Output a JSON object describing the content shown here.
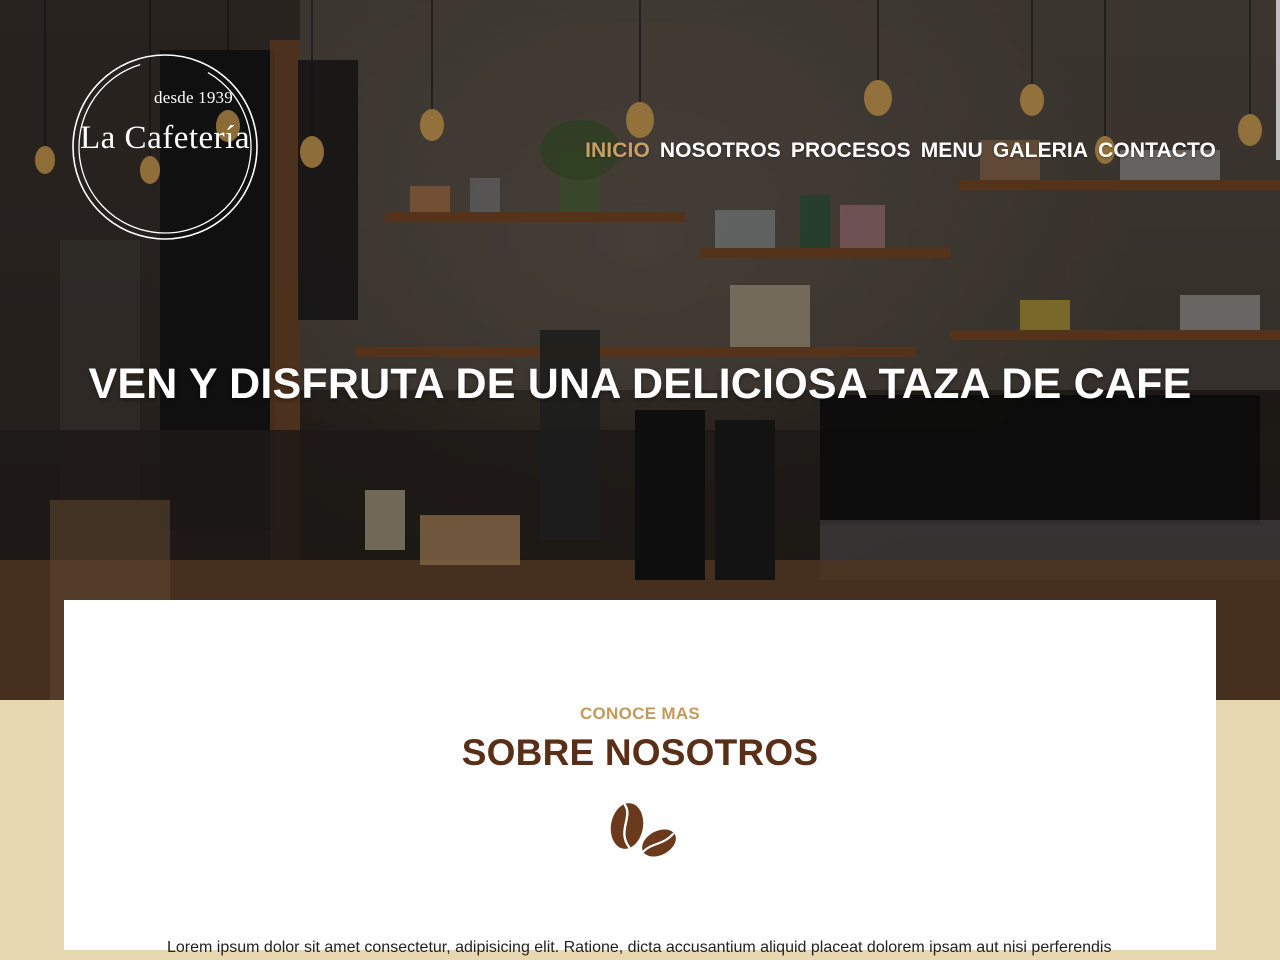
{
  "logo": {
    "since": "desde 1939",
    "name": "La Cafetería"
  },
  "nav": {
    "items": [
      {
        "label": "INICIO",
        "active": true
      },
      {
        "label": "NOSOTROS",
        "active": false
      },
      {
        "label": "PROCESOS",
        "active": false
      },
      {
        "label": "MENU",
        "active": false
      },
      {
        "label": "GALERIA",
        "active": false
      },
      {
        "label": "CONTACTO",
        "active": false
      }
    ]
  },
  "hero": {
    "title": "VEN Y DISFRUTA DE UNA DELICIOSA TAZA DE CAFE"
  },
  "about": {
    "eyebrow": "CONOCE MAS",
    "heading": "SOBRE NOSOTROS",
    "icon": "coffee-beans-icon",
    "text": "Lorem ipsum dolor sit amet consectetur, adipisicing elit. Ratione, dicta accusantium aliquid placeat dolorem ipsam aut nisi perferendis"
  },
  "colors": {
    "accent": "#c8a064",
    "heading": "#5a2f17",
    "beige": "#e8d8b2",
    "white": "#ffffff"
  }
}
